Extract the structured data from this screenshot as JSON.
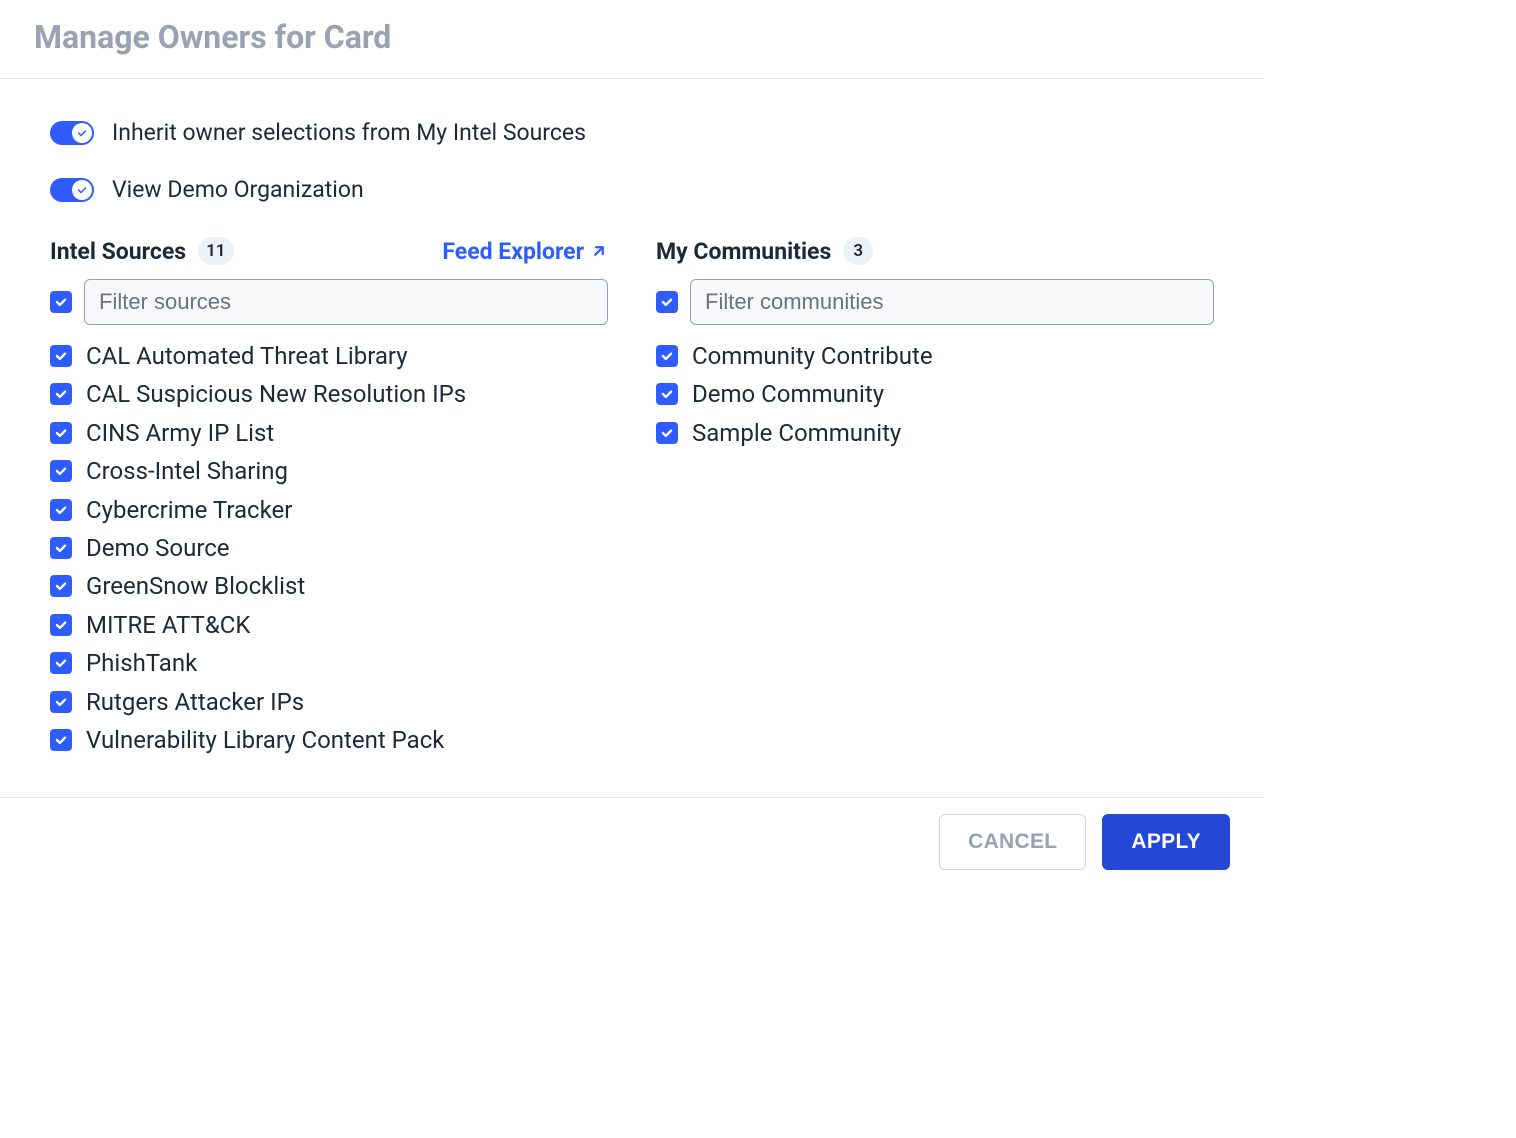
{
  "dialog": {
    "title": "Manage Owners for Card"
  },
  "toggles": {
    "inherit_label": "Inherit owner selections from My Intel Sources",
    "demo_label": "View Demo Organization"
  },
  "intel": {
    "title": "Intel Sources",
    "count": "11",
    "feed_link": "Feed Explorer",
    "filter_placeholder": "Filter sources",
    "items": [
      {
        "label": "CAL Automated Threat Library"
      },
      {
        "label": "CAL Suspicious New Resolution IPs"
      },
      {
        "label": "CINS Army IP List"
      },
      {
        "label": "Cross-Intel Sharing"
      },
      {
        "label": "Cybercrime Tracker"
      },
      {
        "label": "Demo Source"
      },
      {
        "label": "GreenSnow Blocklist"
      },
      {
        "label": "MITRE ATT&CK"
      },
      {
        "label": "PhishTank"
      },
      {
        "label": "Rutgers Attacker IPs"
      },
      {
        "label": "Vulnerability Library Content Pack"
      }
    ]
  },
  "communities": {
    "title": "My Communities",
    "count": "3",
    "filter_placeholder": "Filter communities",
    "items": [
      {
        "label": "Community Contribute"
      },
      {
        "label": "Demo Community"
      },
      {
        "label": "Sample Community"
      }
    ]
  },
  "footer": {
    "cancel": "CANCEL",
    "apply": "APPLY"
  }
}
